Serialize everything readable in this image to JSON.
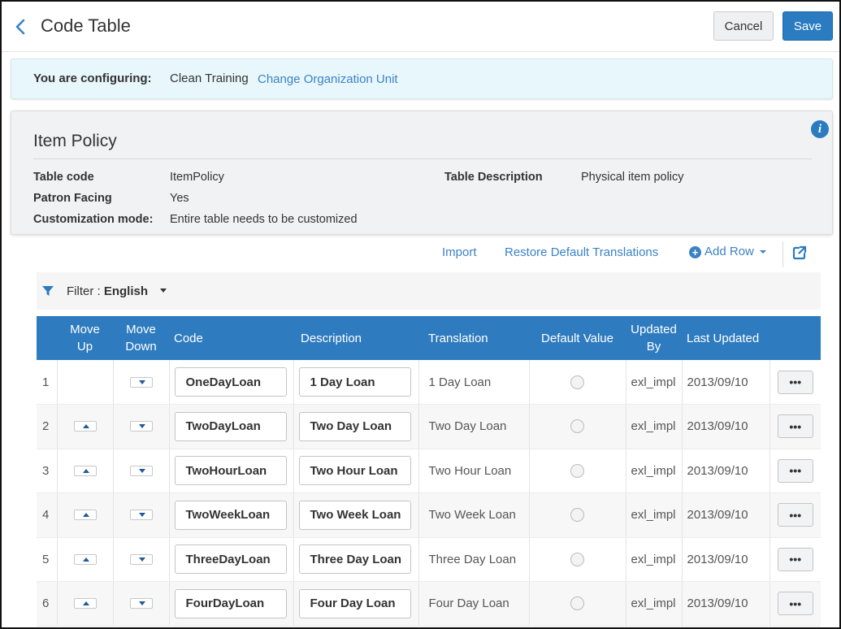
{
  "header": {
    "title": "Code Table",
    "cancel_label": "Cancel",
    "save_label": "Save"
  },
  "config_bar": {
    "label": "You are configuring:",
    "org_name": "Clean Training",
    "change_link": "Change Organization Unit"
  },
  "policy": {
    "title": "Item Policy",
    "table_code_label": "Table code",
    "table_code_value": "ItemPolicy",
    "patron_facing_label": "Patron Facing",
    "patron_facing_value": "Yes",
    "customization_label": "Customization mode:",
    "customization_value": "Entire table needs to be customized",
    "table_description_label": "Table Description",
    "table_description_value": "Physical item policy"
  },
  "toolbar": {
    "import_label": "Import",
    "restore_label": "Restore Default Translations",
    "add_row_label": "Add Row"
  },
  "filter": {
    "label": "Filter :",
    "value": "English"
  },
  "table": {
    "headers": {
      "move_up": "Move Up",
      "move_down": "Move Down",
      "code": "Code",
      "description": "Description",
      "translation": "Translation",
      "default_value": "Default Value",
      "updated_by": "Updated By",
      "last_updated": "Last Updated"
    },
    "rows": [
      {
        "num": "1",
        "code": "OneDayLoan",
        "description": "1 Day Loan",
        "translation": "1 Day Loan",
        "updated_by": "exl_impl",
        "last_updated": "2013/09/10"
      },
      {
        "num": "2",
        "code": "TwoDayLoan",
        "description": "Two Day Loan",
        "translation": "Two Day Loan",
        "updated_by": "exl_impl",
        "last_updated": "2013/09/10"
      },
      {
        "num": "3",
        "code": "TwoHourLoan",
        "description": "Two Hour Loan",
        "translation": "Two Hour Loan",
        "updated_by": "exl_impl",
        "last_updated": "2013/09/10"
      },
      {
        "num": "4",
        "code": "TwoWeekLoan",
        "description": "Two Week Loan",
        "translation": "Two Week Loan",
        "updated_by": "exl_impl",
        "last_updated": "2013/09/10"
      },
      {
        "num": "5",
        "code": "ThreeDayLoan",
        "description": "Three Day Loan",
        "translation": "Three Day Loan",
        "updated_by": "exl_impl",
        "last_updated": "2013/09/10"
      },
      {
        "num": "6",
        "code": "FourDayLoan",
        "description": "Four Day Loan",
        "translation": "Four Day Loan",
        "updated_by": "exl_impl",
        "last_updated": "2013/09/10"
      }
    ],
    "row_action_label": "•••"
  },
  "colors": {
    "accent": "#2a7bc0",
    "table_header": "#2f7bbf",
    "config_bg": "#e8f7fc"
  }
}
